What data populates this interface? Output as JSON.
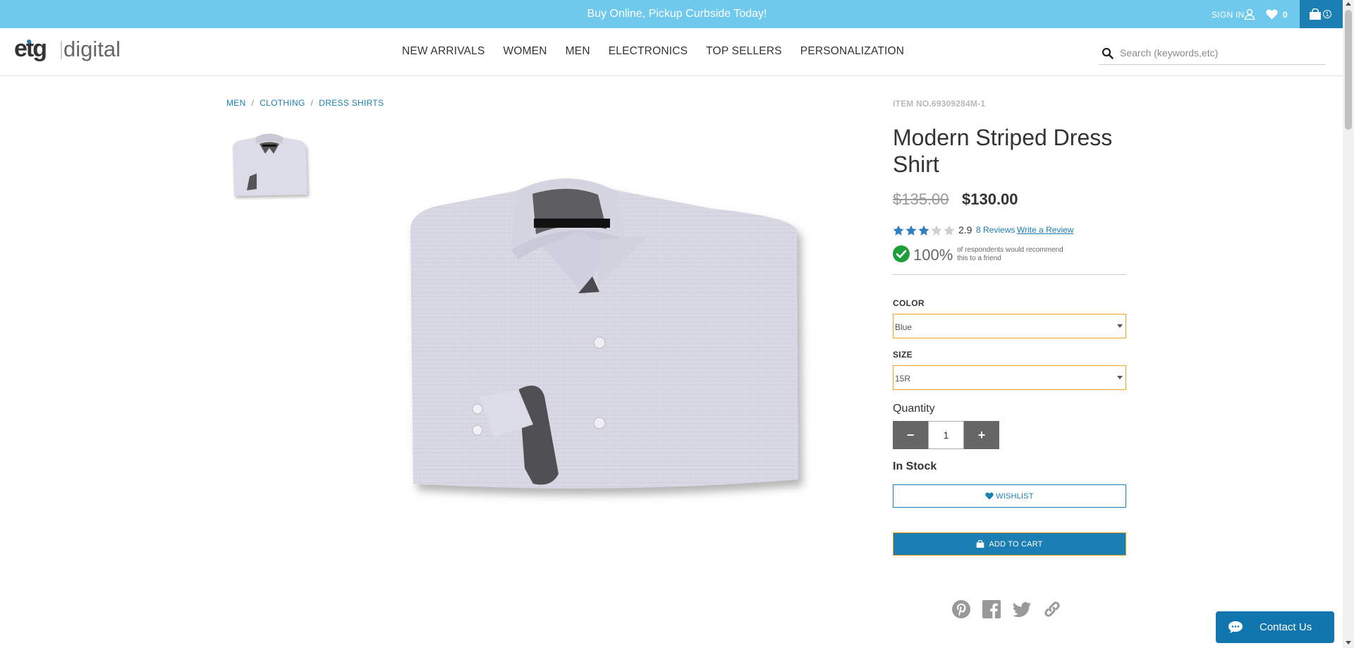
{
  "topbar": {
    "promo": "Buy Online, Pickup Curbside Today!",
    "signin_label": "SIGN IN",
    "wishlist_count": "0",
    "cart_count": "1"
  },
  "header": {
    "logo_text": "etgdigital",
    "nav": [
      "NEW ARRIVALS",
      "WOMEN",
      "MEN",
      "ELECTRONICS",
      "TOP SELLERS",
      "PERSONALIZATION"
    ],
    "search_placeholder": "Search (keywords,etc)"
  },
  "breadcrumb": [
    "MEN",
    "CLOTHING",
    "DRESS SHIRTS"
  ],
  "product": {
    "item_no": "ITEM NO.69309284M-1",
    "title": "Modern Striped Dress Shirt",
    "price_original": "$135.00",
    "price_sale": "$130.00",
    "rating": "2.9",
    "rating_stars_filled": 3,
    "rating_stars_total": 5,
    "reviews_link": "8 Reviews",
    "write_review": "Write a Review",
    "recommend_pct": "100%",
    "recommend_text": "of respondents would recommend this to a friend",
    "color_label": "COLOR",
    "color_value": "Blue",
    "size_label": "SIZE",
    "size_value": "15R",
    "quantity_label": "Quantity",
    "quantity_value": "1",
    "qty_minus": "−",
    "qty_plus": "+",
    "stock": "In Stock",
    "wishlist_label": "WISHLIST",
    "add_to_cart_label": "ADD TO CART"
  },
  "social": [
    "pinterest-icon",
    "facebook-icon",
    "twitter-icon",
    "link-icon"
  ],
  "contact": {
    "label": "Contact Us"
  },
  "colors": {
    "topbar_bg": "#6ec9ec",
    "accent": "#1b7fb3",
    "select_border": "#f0a21b",
    "star": "#2b7fc2"
  }
}
